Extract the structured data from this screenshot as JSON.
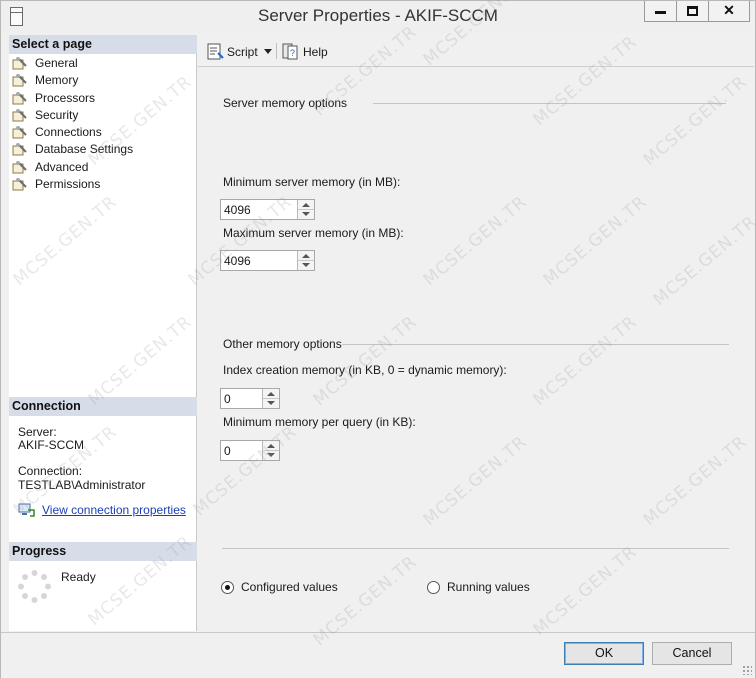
{
  "window": {
    "title": "Server Properties - AKIF-SCCM"
  },
  "left_pane": {
    "select_page_header": "Select a page",
    "pages": [
      {
        "label": "General"
      },
      {
        "label": "Memory"
      },
      {
        "label": "Processors"
      },
      {
        "label": "Security"
      },
      {
        "label": "Connections"
      },
      {
        "label": "Database Settings"
      },
      {
        "label": "Advanced"
      },
      {
        "label": "Permissions"
      }
    ],
    "connection": {
      "header": "Connection",
      "server_label": "Server:",
      "server_value": "AKIF-SCCM",
      "connection_label": "Connection:",
      "connection_value": "TESTLAB\\Administrator",
      "view_properties_link": "View connection properties"
    },
    "progress": {
      "header": "Progress",
      "status": "Ready"
    }
  },
  "toolbar": {
    "script_label": "Script",
    "help_label": "Help"
  },
  "server_memory": {
    "group_label": "Server memory options",
    "min_label": "Minimum server memory (in MB):",
    "min_value": "4096",
    "max_label": "Maximum server memory (in MB):",
    "max_value": "4096"
  },
  "other_memory": {
    "group_label": "Other memory options",
    "index_label": "Index creation memory (in KB, 0 = dynamic memory):",
    "index_value": "0",
    "min_query_label": "Minimum memory per query (in KB):",
    "min_query_value": "0"
  },
  "value_mode": {
    "configured_label": "Configured values",
    "running_label": "Running values",
    "selected": "configured"
  },
  "buttons": {
    "ok_label": "OK",
    "cancel_label": "Cancel"
  },
  "watermark": "MCSE.GEN.TR",
  "colors": {
    "section_header_bg": "#d6dde9",
    "link": "#1a3fb5",
    "ok_border": "#3c7fb1"
  }
}
